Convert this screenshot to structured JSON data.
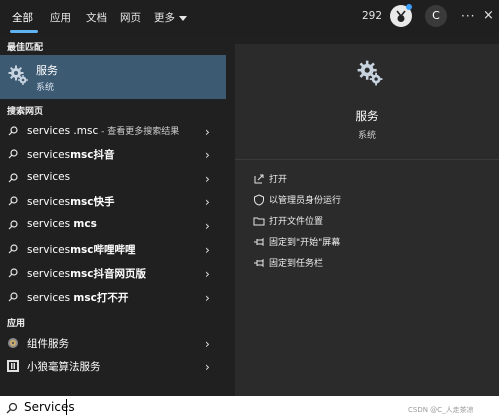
{
  "tabs": [
    {
      "label": "全部"
    },
    {
      "label": "应用"
    },
    {
      "label": "文档"
    },
    {
      "label": "网页"
    },
    {
      "label": "更多"
    }
  ],
  "header": {
    "points": "292",
    "avatar_letter": "C",
    "more": "···",
    "close": "×"
  },
  "sections": {
    "best_match": "最佳匹配",
    "search_web": "搜索网页",
    "apps": "应用"
  },
  "best_match": {
    "title": "服务",
    "subtitle": "系统"
  },
  "web_results": [
    {
      "prefix": "services .msc",
      "suffix": " - 查看更多搜索结果"
    },
    {
      "prefix": "services",
      "bold": "msc抖音"
    },
    {
      "prefix": "services"
    },
    {
      "prefix": "services",
      "bold": "msc快手"
    },
    {
      "prefix": "services ",
      "bold": "mcs"
    },
    {
      "prefix": "services",
      "bold": "msc哔哩哔哩"
    },
    {
      "prefix": "services",
      "bold": "msc抖音网页版"
    },
    {
      "prefix": "services ",
      "bold": "msc打不开"
    }
  ],
  "app_results": [
    {
      "label": "组件服务"
    },
    {
      "label": "小狼毫算法服务"
    }
  ],
  "detail": {
    "title": "服务",
    "subtitle": "系统"
  },
  "actions": [
    {
      "label": "打开",
      "icon": "open-icon"
    },
    {
      "label": "以管理员身份运行",
      "icon": "shield-icon"
    },
    {
      "label": "打开文件位置",
      "icon": "folder-icon"
    },
    {
      "label": "固定到\"开始\"屏幕",
      "icon": "pin-icon"
    },
    {
      "label": "固定到任务栏",
      "icon": "pin-icon"
    }
  ],
  "search": {
    "value": "Services"
  },
  "watermark": "CSDN @C_人走茶凉",
  "colors": {
    "accent": "#5fb2f0",
    "selected": "#3d5a73",
    "panel": "#2b2b2b",
    "background": "#202020"
  }
}
